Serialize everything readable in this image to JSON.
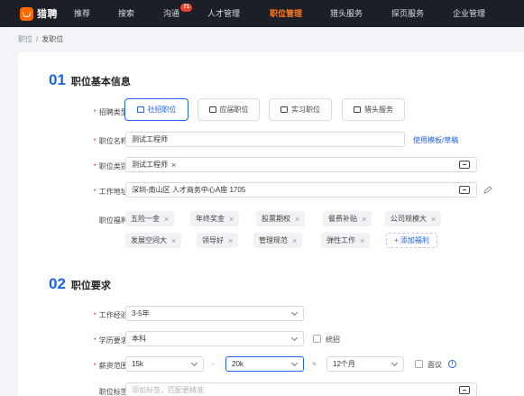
{
  "app": {
    "logo_text": "猎聘"
  },
  "nav": {
    "items": [
      "推荐",
      "搜索",
      "沟通",
      "人才管理",
      "职位管理",
      "猎头服务",
      "探页服务",
      "企业管理"
    ],
    "active_index": 4,
    "badge": "71"
  },
  "breadcrumb": {
    "parent": "职位",
    "separator": "/",
    "current": "发职位"
  },
  "section1": {
    "num": "01",
    "title": "职位基本信息"
  },
  "section2": {
    "num": "02",
    "title": "职位要求"
  },
  "form": {
    "recruit_type": {
      "label": "招聘类型:",
      "options": [
        "社招职位",
        "应届职位",
        "实习职位",
        "猎头服务"
      ],
      "selected_index": 0
    },
    "job_name": {
      "label": "职位名称:",
      "value": "测试工程师",
      "link": "使用模板/草稿"
    },
    "job_category": {
      "label": "职位类别:",
      "value": "测试工程师"
    },
    "address": {
      "label": "工作地址:",
      "value": "深圳-南山区 人才商务中心A座 1705"
    },
    "benefits": {
      "label": "职位福利:",
      "items": [
        "五险一金",
        "年终奖金",
        "股票期权",
        "餐费补贴",
        "公司规模大",
        "发展空间大",
        "领导好",
        "管理规范",
        "弹性工作"
      ],
      "add_label": "+ 添加福利"
    },
    "experience": {
      "label": "工作经验:",
      "value": "3-5年"
    },
    "education": {
      "label": "学历要求:",
      "value": "本科",
      "checkbox_label": "统招"
    },
    "salary": {
      "label": "薪资范围:",
      "min": "15k",
      "dash": "-",
      "max": "20k",
      "times": "×",
      "months": "12个月",
      "checkbox_label": "面议",
      "info": "i"
    },
    "tags": {
      "label": "职位标签:",
      "placeholder": "添加标签，匹配更精准"
    }
  },
  "colors": {
    "brand": "#ff6a00",
    "accent": "#1d62f0",
    "required": "#f0442f",
    "nav_bg": "#1c1f26"
  }
}
